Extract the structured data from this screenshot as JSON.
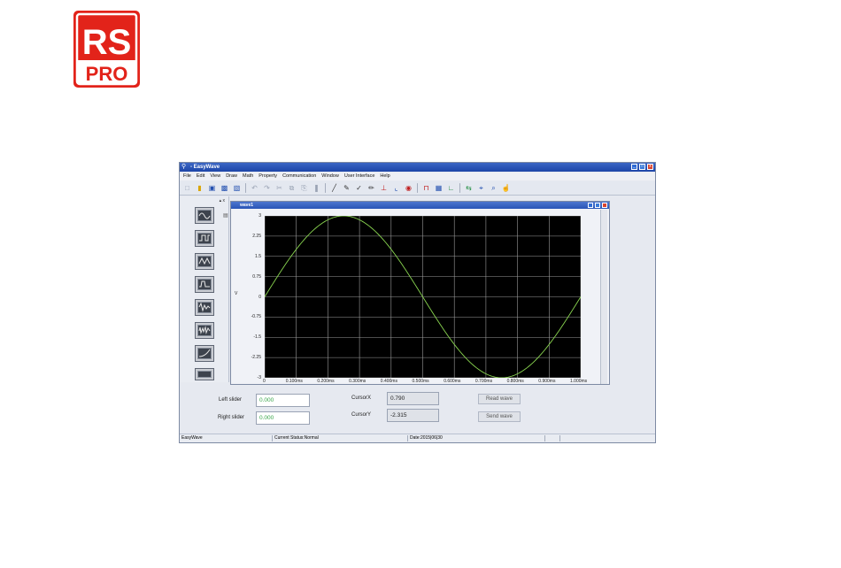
{
  "logo": {
    "top": "RS",
    "bottom": "PRO",
    "color": "#e2231a"
  },
  "window": {
    "title": "- EasyWave",
    "menu": [
      "File",
      "Edit",
      "View",
      "Draw",
      "Math",
      "Property",
      "Communication",
      "Window",
      "User Interface",
      "Help"
    ]
  },
  "subwindow": {
    "title": "wave1"
  },
  "plot": {
    "y_unit": "V",
    "y_ticks": [
      "3",
      "2.25",
      "1.5",
      "0.75",
      "0",
      "-0.75",
      "-1.5",
      "-2.25",
      "-3"
    ],
    "x_ticks": [
      "0",
      "0.100ms",
      "0.200ms",
      "0.300ms",
      "0.400ms",
      "0.500ms",
      "0.600ms",
      "0.700ms",
      "0.800ms",
      "0.900ms",
      "1.000ms"
    ],
    "line_color": "#8ad650",
    "grid_color": "#9a9a9a",
    "background": "#000000"
  },
  "chart_data": {
    "type": "line",
    "x": [
      0,
      0.1,
      0.2,
      0.25,
      0.3,
      0.4,
      0.5,
      0.6,
      0.7,
      0.75,
      0.8,
      0.9,
      1.0
    ],
    "series": [
      {
        "values": [
          0,
          1.76,
          2.85,
          3,
          2.85,
          1.76,
          0,
          -1.76,
          -2.85,
          -3,
          -2.85,
          -1.76,
          0
        ]
      }
    ],
    "ylim": [
      -3,
      3
    ],
    "xlim": [
      0,
      1.0
    ],
    "ylabel": "V",
    "xlabel": "",
    "grid": true
  },
  "controls": {
    "left_slider_label": "Left slider",
    "left_slider_value": "0.000",
    "right_slider_label": "Right slider",
    "right_slider_value": "0.000",
    "cursor_x_label": "CursorX",
    "cursor_x_value": "0.790",
    "cursor_y_label": "CursorY",
    "cursor_y_value": "-2.315",
    "read_wave": "Read wave",
    "send_wave": "Send wave"
  },
  "status": {
    "app": "EasyWave",
    "current": "Current Status:Normal",
    "date": "Date:2015|06|30"
  }
}
